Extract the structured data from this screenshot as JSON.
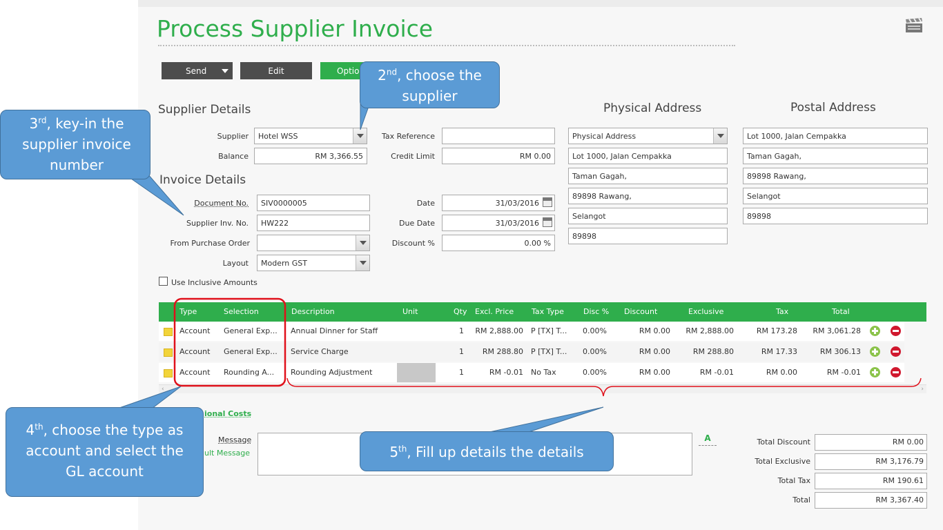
{
  "page": {
    "title": "Process Supplier Invoice"
  },
  "toolbar": {
    "send_label": "Send",
    "edit_label": "Edit",
    "options_label": "Optio"
  },
  "supplier_details": {
    "heading": "Supplier Details",
    "supplier_label": "Supplier",
    "supplier_value": "Hotel WSS",
    "balance_label": "Balance",
    "balance_value": "RM 3,366.55",
    "tax_ref_label": "Tax Reference",
    "tax_ref_value": "",
    "credit_limit_label": "Credit Limit",
    "credit_limit_value": "RM 0.00"
  },
  "invoice_details": {
    "heading": "Invoice Details",
    "doc_no_label": "Document No.",
    "doc_no_value": "SIV0000005",
    "supplier_inv_label": "Supplier Inv. No.",
    "supplier_inv_value": "HW222",
    "po_label": "From Purchase Order",
    "po_value": "",
    "layout_label": "Layout",
    "layout_value": "Modern GST",
    "date_label": "Date",
    "date_value": "31/03/2016",
    "due_date_label": "Due Date",
    "due_date_value": "31/03/2016",
    "discount_label": "Discount %",
    "discount_value": "0.00 %",
    "inclusive_label": "Use Inclusive Amounts"
  },
  "physical_address": {
    "heading": "Physical Address",
    "type_value": "Physical Address",
    "lines": [
      "Lot 1000, Jalan Cempakka",
      "Taman Gagah,",
      "89898 Rawang,",
      "Selangot",
      "89898"
    ]
  },
  "postal_address": {
    "heading": "Postal Address",
    "lines": [
      "Lot 1000, Jalan Cempakka",
      "Taman Gagah,",
      "89898 Rawang,",
      "Selangot",
      "89898"
    ]
  },
  "grid": {
    "headers": [
      "Type",
      "Selection",
      "Description",
      "Unit",
      "Qty",
      "Excl. Price",
      "Tax Type",
      "Disc %",
      "Discount",
      "Exclusive",
      "Tax",
      "Total"
    ],
    "rows": [
      [
        "Account",
        "General Exp...",
        "Annual Dinner for Staff",
        "",
        "1",
        "RM 2,888.00",
        "P [TX] T...",
        "0.00%",
        "RM 0.00",
        "RM 2,888.00",
        "RM 173.28",
        "RM 3,061.28"
      ],
      [
        "Account",
        "General Exp...",
        "Service Charge",
        "",
        "1",
        "RM 288.80",
        "P [TX] T...",
        "0.00%",
        "RM 0.00",
        "RM 288.80",
        "RM 17.33",
        "RM 306.13"
      ],
      [
        "Account",
        "Rounding A...",
        "Rounding Adjustment",
        "",
        "1",
        "RM -0.01",
        "No Tax",
        "0.00%",
        "RM 0.00",
        "RM -0.01",
        "RM 0.00",
        "RM -0.01"
      ]
    ]
  },
  "footer": {
    "additional_costs_label": "ional Costs",
    "message_label": "Message",
    "default_message_label": "ult Message",
    "message_value": "",
    "spell_label": "A"
  },
  "totals": {
    "total_discount_label": "Total Discount",
    "total_discount_value": "RM 0.00",
    "total_exclusive_label": "Total Exclusive",
    "total_exclusive_value": "RM 3,176.79",
    "total_tax_label": "Total Tax",
    "total_tax_value": "RM 190.61",
    "total_label": "Total",
    "total_value": "RM 3,367.40"
  },
  "callouts": {
    "step2_sup": "nd",
    "step2_text": ", choose the supplier",
    "step2_num": "2",
    "step3_sup": "rd",
    "step3_text": ", key-in the supplier invoice number",
    "step3_num": "3",
    "step4_sup": "th",
    "step4_text": ", choose the type as account and select the GL account",
    "step4_num": "4",
    "step5_sup": "th",
    "step5_text": ", Fill up details the details",
    "step5_num": "5"
  },
  "colors": {
    "accent": "#2fae4c",
    "callout": "#5b9bd5",
    "highlight": "#e0101a",
    "toolbar_dark": "#4d4d4d"
  }
}
